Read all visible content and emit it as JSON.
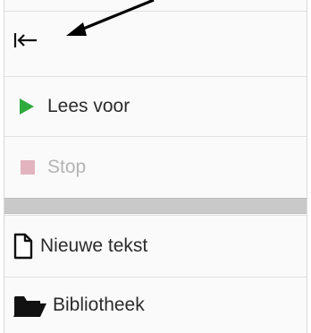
{
  "menu": {
    "collapse_icon": "collapse-left-icon",
    "read_aloud": {
      "label": "Lees voor",
      "icon": "play-icon",
      "icon_color": "#2eaa3c",
      "enabled": true
    },
    "stop": {
      "label": "Stop",
      "icon": "stop-icon",
      "icon_color": "#e2b4bf",
      "enabled": false
    },
    "new_text": {
      "label": "Nieuwe tekst",
      "icon": "new-document-icon"
    },
    "library": {
      "label": "Bibliotheek",
      "icon": "folder-open-icon"
    }
  },
  "annotation": {
    "icon": "pointer-arrow-icon",
    "color": "#000000"
  }
}
